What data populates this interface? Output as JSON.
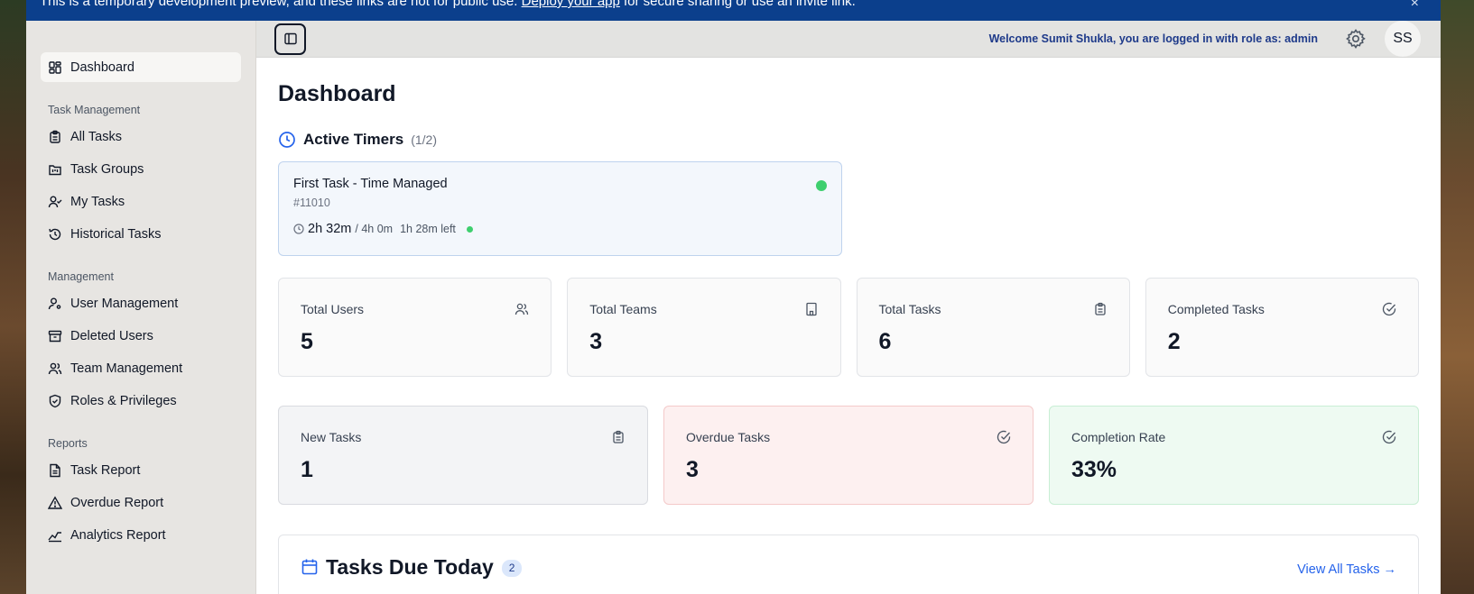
{
  "banner": {
    "text_before": "This is a temporary development preview, and these links are not for public use. ",
    "link": "Deploy your app",
    "text_after": " for secure sharing or use an invite link.",
    "close": "×"
  },
  "sidebar": {
    "dashboard": "Dashboard",
    "sections": {
      "task_management": "Task Management",
      "management": "Management",
      "reports": "Reports"
    },
    "task_items": [
      "All Tasks",
      "Task Groups",
      "My Tasks",
      "Historical Tasks"
    ],
    "management_items": [
      "User Management",
      "Deleted Users",
      "Team Management",
      "Roles & Privileges"
    ],
    "report_items": [
      "Task Report",
      "Overdue Report",
      "Analytics Report"
    ]
  },
  "topbar": {
    "welcome": "Welcome Sumit Shukla, you are logged in with role as: admin",
    "avatar": "SS"
  },
  "page": {
    "title": "Dashboard"
  },
  "timers": {
    "title": "Active Timers",
    "count": "(1/2)",
    "card": {
      "name": "First Task - Time Managed",
      "id": "#11010",
      "elapsed": "2h 32m",
      "total": "/ 4h 0m",
      "left": "1h 28m left"
    }
  },
  "stats": [
    {
      "label": "Total Users",
      "value": "5"
    },
    {
      "label": "Total Teams",
      "value": "3"
    },
    {
      "label": "Total Tasks",
      "value": "6"
    },
    {
      "label": "Completed Tasks",
      "value": "2"
    }
  ],
  "stats2": [
    {
      "label": "New Tasks",
      "value": "1"
    },
    {
      "label": "Overdue Tasks",
      "value": "3"
    },
    {
      "label": "Completion Rate",
      "value": "33%"
    }
  ],
  "due": {
    "title": "Tasks Due Today",
    "badge": "2",
    "link": "View All Tasks →"
  },
  "colors": {
    "banner": "#0b3f8c",
    "accent": "#2563eb",
    "active_dot": "#3ecf6e"
  }
}
